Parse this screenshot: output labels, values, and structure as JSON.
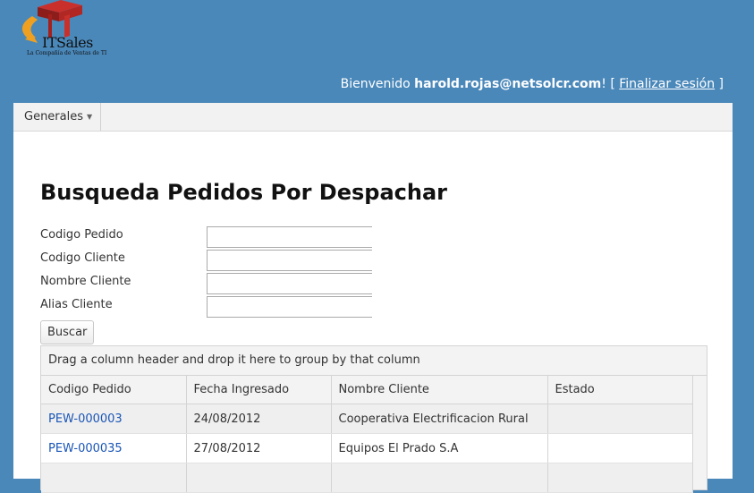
{
  "logo": {
    "name": "ITSales",
    "tagline": "La Compañía de Ventas de TI"
  },
  "header": {
    "welcome_prefix": "Bienvenido ",
    "user": "harold.rojas@netsolcr.com",
    "after_user": "! [ ",
    "logout": "Finalizar sesión",
    "close_bracket": " ]"
  },
  "menu": {
    "items": [
      {
        "label": "Generales"
      }
    ]
  },
  "page": {
    "title": "Busqueda Pedidos Por Despachar"
  },
  "form": {
    "fields": [
      {
        "label": "Codigo Pedido",
        "value": ""
      },
      {
        "label": "Codigo Cliente",
        "value": ""
      },
      {
        "label": "Nombre Cliente",
        "value": ""
      },
      {
        "label": "Alias Cliente",
        "value": ""
      }
    ],
    "search_button": "Buscar"
  },
  "grid": {
    "group_hint": "Drag a column header and drop it here to group by that column",
    "columns": [
      "Codigo Pedido",
      "Fecha Ingresado",
      "Nombre Cliente",
      "Estado"
    ],
    "rows": [
      {
        "codigo": "PEW-000003",
        "fecha": "24/08/2012",
        "nombre": "Cooperativa Electrificacion Rural",
        "estado": ""
      },
      {
        "codigo": "PEW-000035",
        "fecha": "27/08/2012",
        "nombre": "Equipos El Prado S.A",
        "estado": ""
      }
    ]
  },
  "colors": {
    "background": "#4a88ba",
    "link": "#1a55b6",
    "logo_red": "#c9302c",
    "logo_orange": "#f0a020"
  },
  "icons": {
    "menu_caret": "caret-down-icon"
  }
}
